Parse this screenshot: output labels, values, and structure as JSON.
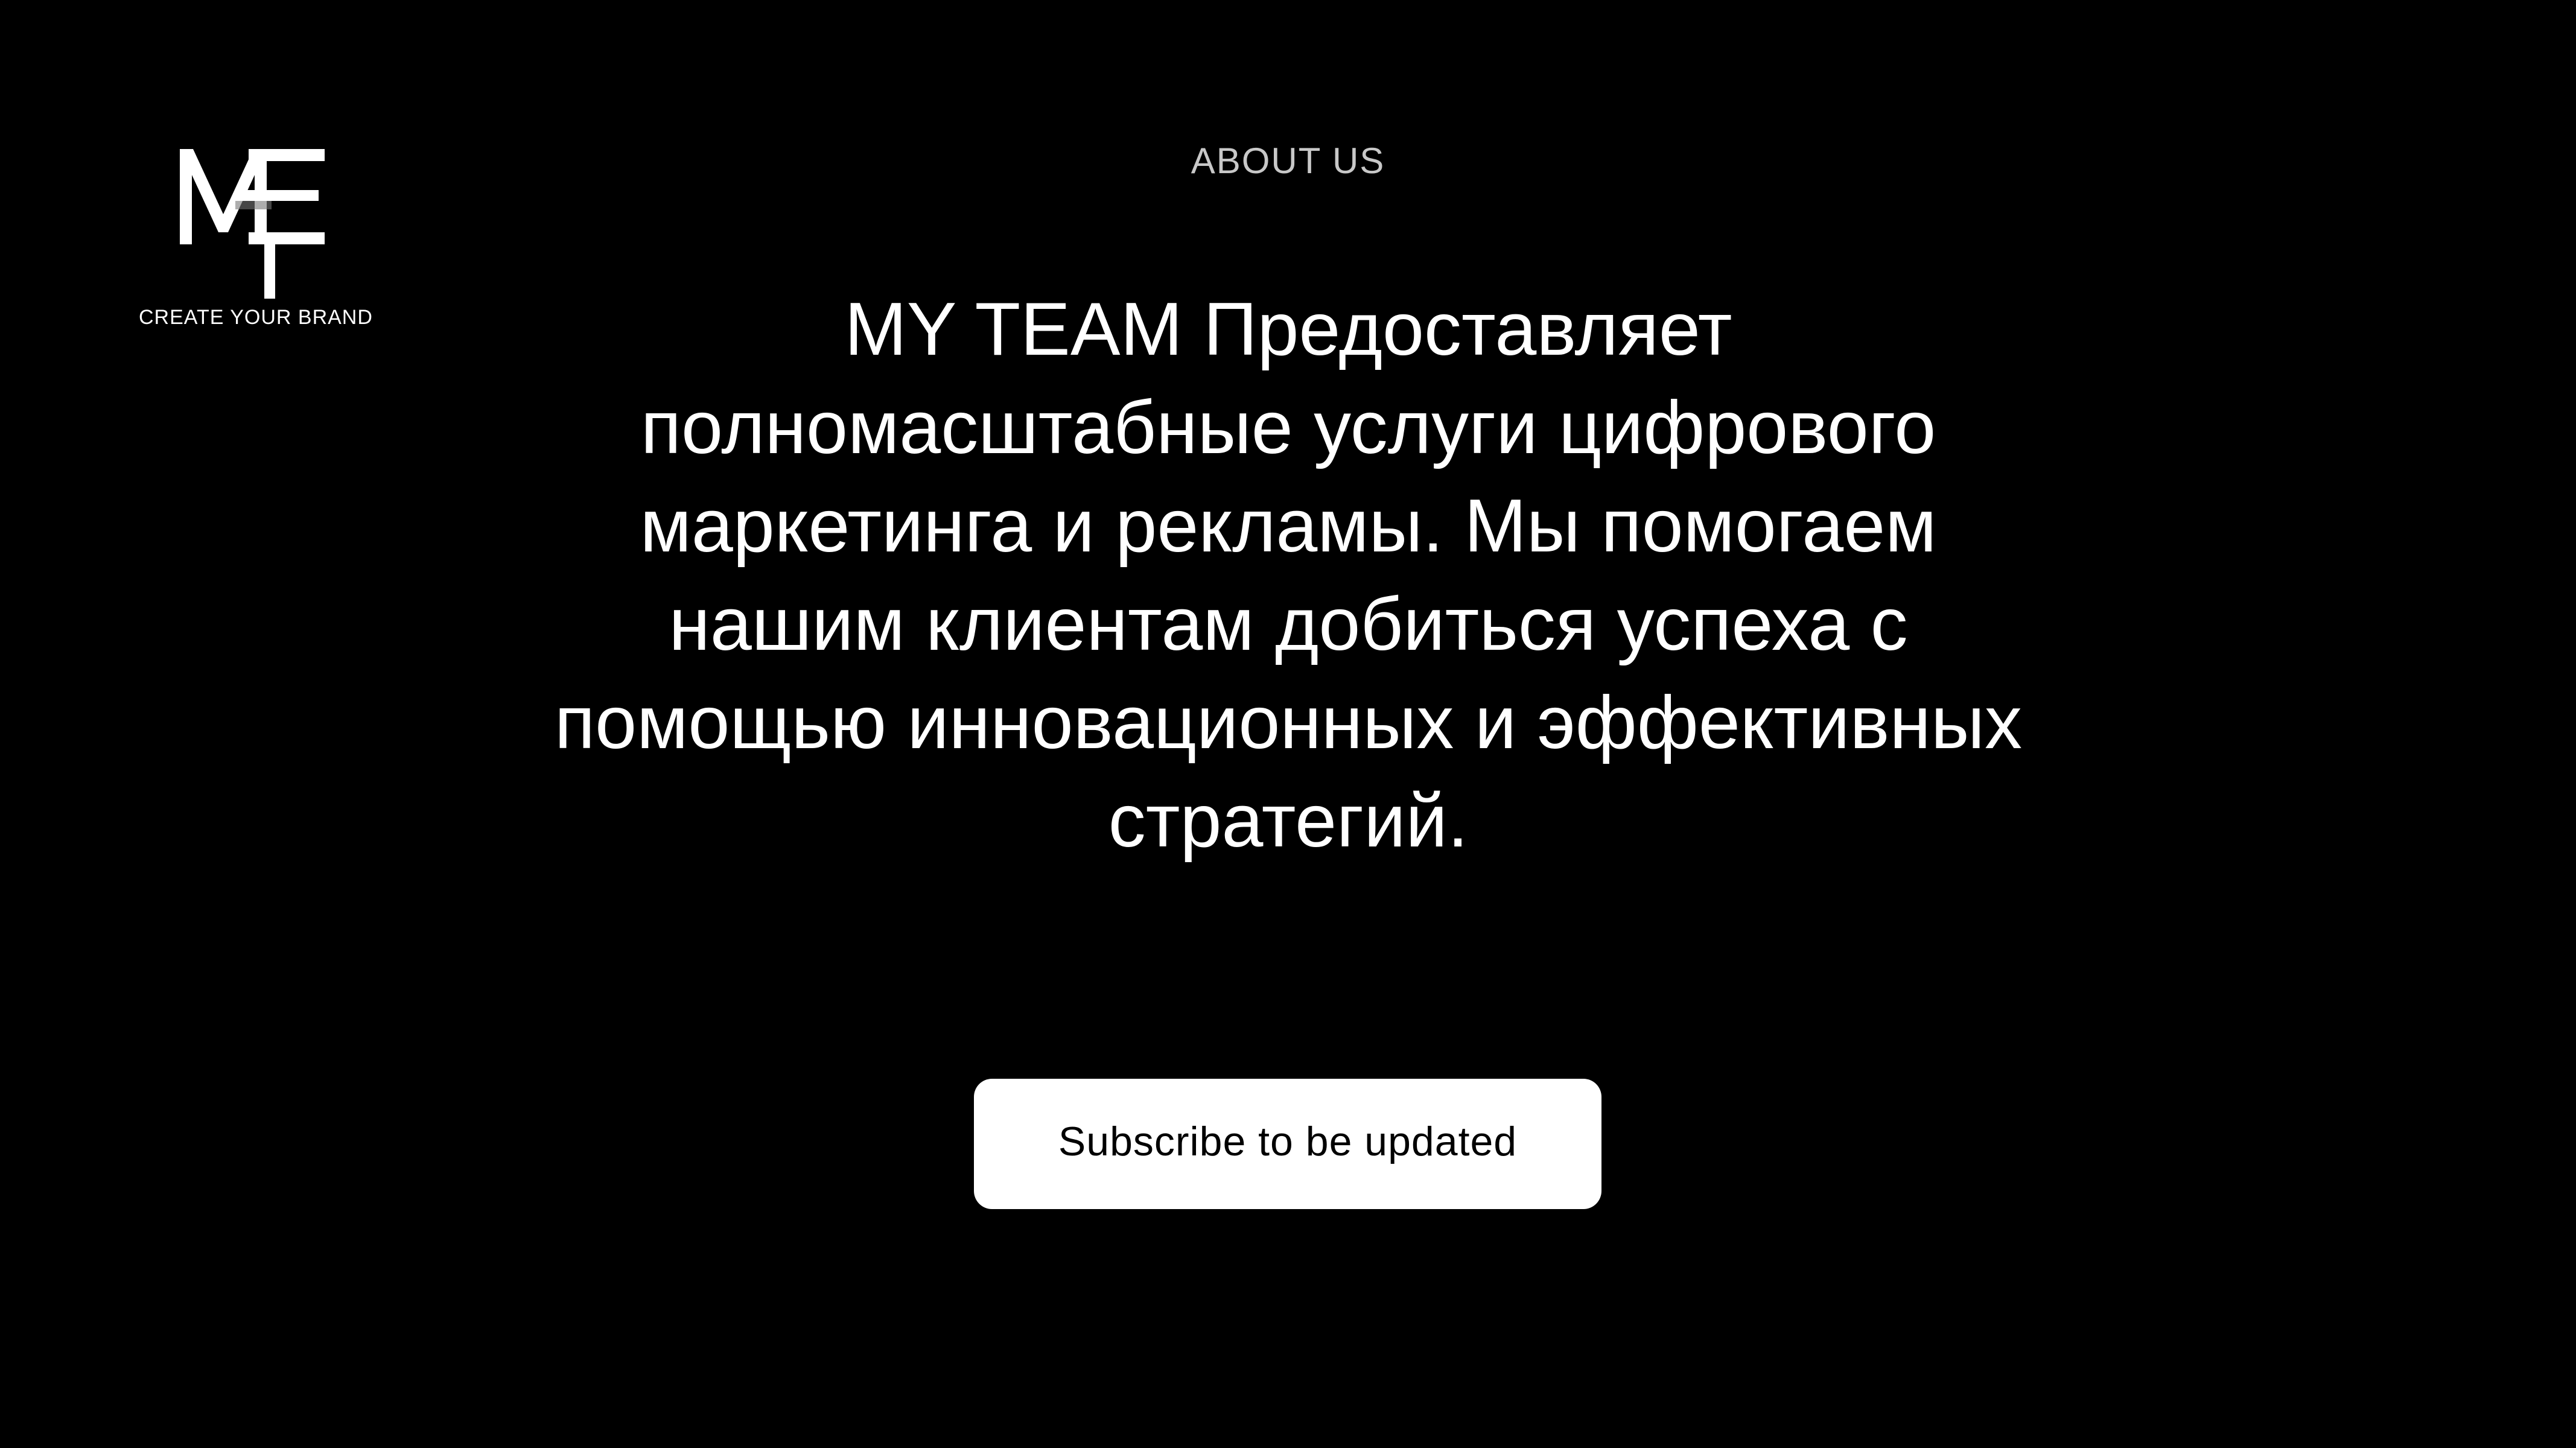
{
  "brand": {
    "logo_mark": "MEFT",
    "tagline": "CREATE YOUR BRAND",
    "logo_icon": "mef-monogram-icon"
  },
  "section": {
    "eyebrow": "ABOUT US",
    "headline": "MY TEAM Предоставляет полномасштабные услуги цифрового маркетинга и рекламы. Мы помогаем нашим клиентам добиться успеха с помощью инновационных и эффективных стратегий."
  },
  "cta": {
    "subscribe_label": "Subscribe to be updated"
  },
  "colors": {
    "background": "#000000",
    "text": "#ffffff",
    "eyebrow": "#c8c8c8",
    "button_bg": "#ffffff",
    "button_text": "#000000"
  }
}
